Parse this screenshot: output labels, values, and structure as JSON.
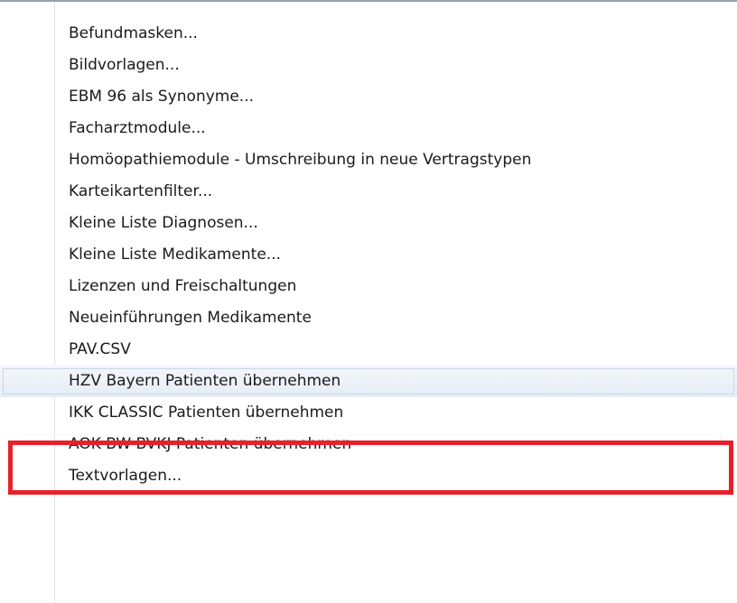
{
  "menu": {
    "items": [
      {
        "label": "Befundmasken..."
      },
      {
        "label": "Bildvorlagen..."
      },
      {
        "label": "EBM 96 als Synonyme..."
      },
      {
        "label": "Facharztmodule..."
      },
      {
        "label": "Homöopathiemodule - Umschreibung in neue Vertragstypen"
      },
      {
        "label": "Karteikartenfilter..."
      },
      {
        "label": "Kleine Liste Diagnosen..."
      },
      {
        "label": "Kleine Liste Medikamente..."
      },
      {
        "label": "Lizenzen und Freischaltungen"
      },
      {
        "label": "Neueinführungen Medikamente"
      },
      {
        "label": "PAV.CSV"
      },
      {
        "label": "HZV Bayern Patienten übernehmen"
      },
      {
        "label": "IKK CLASSIC Patienten übernehmen"
      },
      {
        "label": "AOK BW BVKJ Patienten übernehmen"
      },
      {
        "label": "Textvorlagen..."
      }
    ],
    "highlighted_item": "HZV Bayern Patienten übernehmen",
    "colors": {
      "highlight_frame": "#e8202a",
      "hover_background": "#e7edf6",
      "text": "#1a1a1a"
    }
  }
}
